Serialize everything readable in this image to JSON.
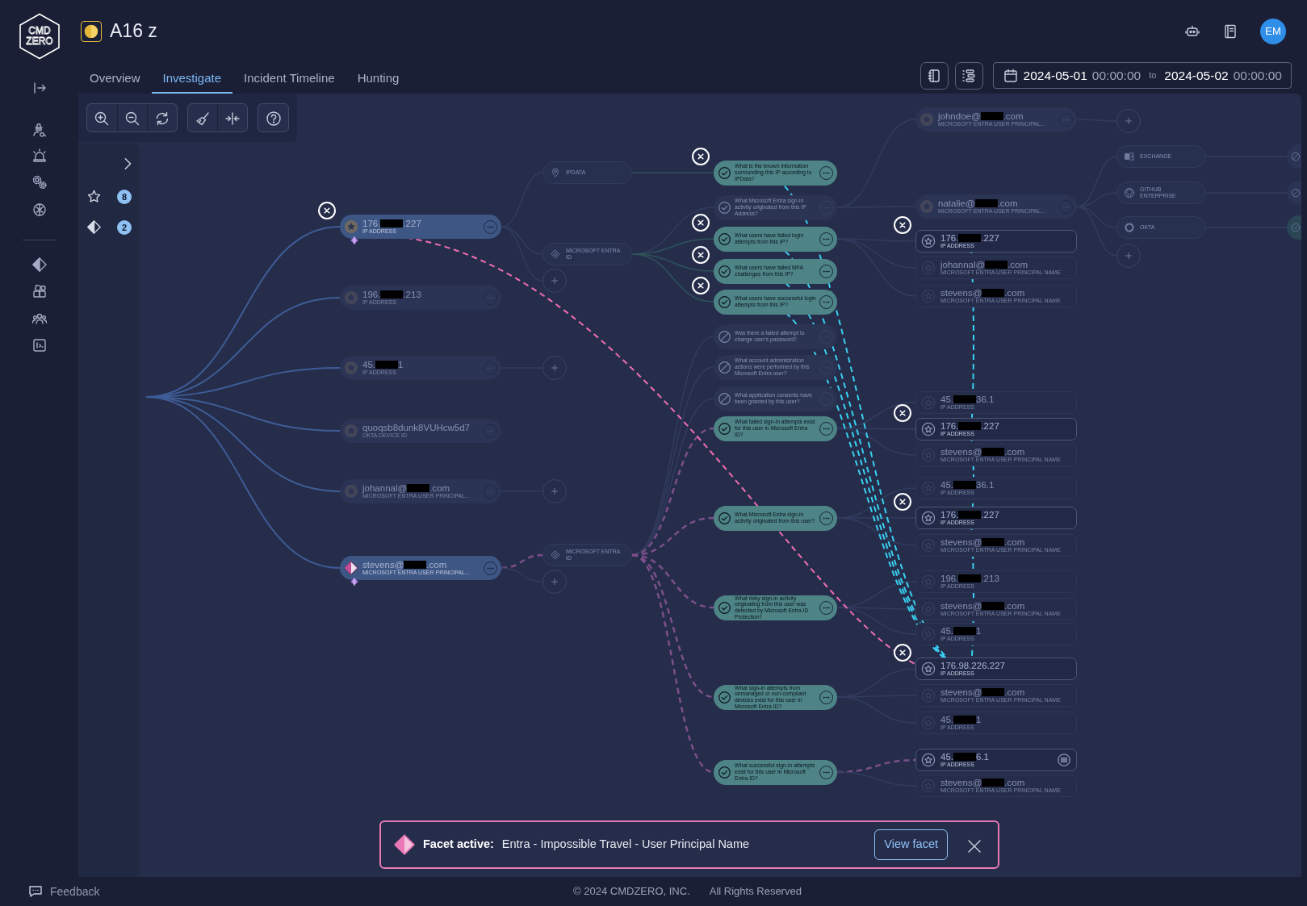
{
  "logo": {
    "lines": [
      "CMD",
      "ZERO"
    ]
  },
  "case": {
    "title": "A16 z"
  },
  "user": {
    "initials": "EM"
  },
  "tabs": [
    {
      "label": "Overview",
      "selected": false
    },
    {
      "label": "Investigate",
      "selected": true
    },
    {
      "label": "Incident Timeline",
      "selected": false
    },
    {
      "label": "Hunting",
      "selected": false
    }
  ],
  "date_range": {
    "start_date": "2024-05-01",
    "start_time": "00:00:00",
    "separator": "to",
    "end_date": "2024-05-02",
    "end_time": "00:00:00"
  },
  "side_panel": {
    "favorites_count": "8",
    "facets_count": "2"
  },
  "graph": {
    "nodes": [
      {
        "kind": "entity",
        "value": [
          "176.",
          ".227"
        ],
        "type": "IP ADDRESS",
        "dimmed": false,
        "pinned": true,
        "trail": {
          "color": "#ef6db0"
        },
        "facet_tag": true,
        "children": [
          {
            "kind": "integration",
            "name": "IPDATA",
            "children": [
              {
                "kind": "question",
                "text": "What is the known information surrounding this IP according to IPData?",
                "skipped": false,
                "dimmed": false,
                "pinned": true,
                "trail": {
                  "color": "#3ad1f2"
                }
              }
            ]
          },
          {
            "kind": "integration",
            "name": "MICROSOFT ENTRA ID",
            "children": [
              {
                "kind": "question",
                "text": "What Microsoft Entra sign-in activity originated from this IP Address?",
                "skipped": false,
                "dimmed": true,
                "children": [
                  {
                    "kind": "entity",
                    "value": [
                      "johndoe@",
                      ".com"
                    ],
                    "type": "MICROSOFT ENTRA USER PRINCIPAL...",
                    "dimmed": true,
                    "children": [
                      {
                        "kind": "add"
                      }
                    ]
                  },
                  {
                    "kind": "entity",
                    "value": [
                      "natalie@",
                      ".com"
                    ],
                    "type": "MICROSOFT ENTRA USER PRINCIPAL...",
                    "dimmed": true,
                    "children": [
                      {
                        "kind": "integration",
                        "name": "EXCHANGE",
                        "children": [
                          {
                            "kind": "stub",
                            "skipped": true
                          }
                        ]
                      },
                      {
                        "kind": "integration",
                        "name": "GITHUB ENTERPRISE",
                        "children": [
                          {
                            "kind": "stub",
                            "skipped": true
                          }
                        ]
                      },
                      {
                        "kind": "integration",
                        "name": "OKTA",
                        "children": [
                          {
                            "kind": "stub",
                            "skipped": false
                          }
                        ]
                      },
                      {
                        "kind": "add"
                      }
                    ]
                  }
                ]
              },
              {
                "kind": "question",
                "text": "What users have failed login attempts from this IP?",
                "skipped": false,
                "dimmed": false,
                "pinned": true,
                "trail": {
                  "color": "#3ad1f2"
                },
                "children": [
                  {
                    "kind": "result",
                    "value": [
                      "176.",
                      ".227"
                    ],
                    "type": "IP ADDRESS",
                    "dimmed": false,
                    "pinned": true,
                    "trail": {
                      "color": "#3ad1f2"
                    }
                  },
                  {
                    "kind": "result",
                    "value": [
                      "johannal@",
                      ".com"
                    ],
                    "type": "MICROSOFT ENTRA USER PRINCIPAL NAME",
                    "dimmed": true
                  },
                  {
                    "kind": "result",
                    "value": [
                      "stevens@",
                      ".com"
                    ],
                    "type": "MICROSOFT ENTRA USER PRINCIPAL NAME",
                    "dimmed": true
                  }
                ]
              },
              {
                "kind": "question",
                "text": "What users have failed MFA challenges from this IP?",
                "skipped": false,
                "dimmed": false,
                "pinned": true,
                "trail": {
                  "color": "#3ad1f2"
                }
              },
              {
                "kind": "question",
                "text": "What users have successful login attempts from this IP?",
                "skipped": false,
                "dimmed": false,
                "pinned": true,
                "trail": {
                  "color": "#3ad1f2"
                }
              }
            ]
          },
          {
            "kind": "add"
          }
        ]
      },
      {
        "kind": "entity",
        "value": [
          "196.",
          ".213"
        ],
        "type": "IP ADDRESS",
        "dimmed": true
      },
      {
        "kind": "entity",
        "value": [
          "45.",
          "1"
        ],
        "type": "IP ADDRESS",
        "dimmed": true,
        "children": [
          {
            "kind": "add"
          }
        ]
      },
      {
        "kind": "entity",
        "value": [
          "quoqsb8dunk8VUHcw5d7"
        ],
        "type": "OKTA DEVICE ID",
        "dimmed": true
      },
      {
        "kind": "entity",
        "value": [
          "johannal@",
          ".com"
        ],
        "type": "MICROSOFT ENTRA USER PRINCIPAL...",
        "dimmed": true,
        "children": [
          {
            "kind": "add"
          }
        ]
      },
      {
        "kind": "facet-entity",
        "value": [
          "stevens@",
          ".com"
        ],
        "type": "MICROSOFT ENTRA USER PRINCIPAL...",
        "dimmed": false,
        "facet_tag": true,
        "children": [
          {
            "kind": "integration",
            "name": "MICROSOFT ENTRA ID",
            "facet_path": true,
            "children": [
              {
                "kind": "question",
                "text": "Was there a failed attempt to change user's password?",
                "skipped": true,
                "dimmed": true
              },
              {
                "kind": "question",
                "text": "What account administration actions were performed by this Microsoft Entra user?",
                "skipped": true,
                "dimmed": true
              },
              {
                "kind": "question",
                "text": "What application consents have been granted by this user?",
                "skipped": true,
                "dimmed": true
              },
              {
                "kind": "question",
                "text": "What failed sign-in attempts exist for this user in Microsoft Entra ID?",
                "skipped": false,
                "dimmed": false,
                "facet_path": true,
                "children": [
                  {
                    "kind": "result",
                    "value": [
                      "45.",
                      "36.1"
                    ],
                    "type": "IP ADDRESS",
                    "dimmed": true
                  },
                  {
                    "kind": "result",
                    "value": [
                      "176.",
                      ".227"
                    ],
                    "type": "IP ADDRESS",
                    "dimmed": false,
                    "pinned": true,
                    "trail": {
                      "color": "#3ad1f2"
                    }
                  },
                  {
                    "kind": "result",
                    "value": [
                      "stevens@",
                      ".com"
                    ],
                    "type": "MICROSOFT ENTRA USER PRINCIPAL NAME",
                    "dimmed": true
                  }
                ]
              },
              {
                "kind": "question",
                "text": "What Microsoft Entra sign-in activity originated from this user?",
                "skipped": false,
                "dimmed": false,
                "facet_path": true,
                "children": [
                  {
                    "kind": "result",
                    "value": [
                      "45.",
                      "36.1"
                    ],
                    "type": "IP ADDRESS",
                    "dimmed": true
                  },
                  {
                    "kind": "result",
                    "value": [
                      "176.",
                      ".227"
                    ],
                    "type": "IP ADDRESS",
                    "dimmed": false,
                    "pinned": true,
                    "trail": {
                      "color": "#3ad1f2"
                    }
                  },
                  {
                    "kind": "result",
                    "value": [
                      "stevens@",
                      ".com"
                    ],
                    "type": "MICROSOFT ENTRA USER PRINCIPAL NAME",
                    "dimmed": true
                  }
                ]
              },
              {
                "kind": "question",
                "text": "What risky sign-in activity originating from this user was detected by Microsoft Entra ID Protection?",
                "skipped": false,
                "dimmed": false,
                "facet_path": true,
                "children": [
                  {
                    "kind": "result",
                    "value": [
                      "196.",
                      ".213"
                    ],
                    "type": "IP ADDRESS",
                    "dimmed": true
                  },
                  {
                    "kind": "result",
                    "value": [
                      "stevens@",
                      ".com"
                    ],
                    "type": "MICROSOFT ENTRA USER PRINCIPAL NAME",
                    "dimmed": true
                  },
                  {
                    "kind": "result",
                    "value": [
                      "45.",
                      "1"
                    ],
                    "type": "IP ADDRESS",
                    "dimmed": true
                  }
                ]
              },
              {
                "kind": "question",
                "text": "What sign-in attempts from unmanaged or non-compliant devices exist for this user in Microsoft Entra ID?",
                "skipped": false,
                "dimmed": false,
                "facet_path": true,
                "children": [
                  {
                    "kind": "result",
                    "value": [
                      "176.98.226.227"
                    ],
                    "type": "IP ADDRESS",
                    "dimmed": false,
                    "pinned": true,
                    "focus": true
                  },
                  {
                    "kind": "result",
                    "value": [
                      "stevens@",
                      ".com"
                    ],
                    "type": "MICROSOFT ENTRA USER PRINCIPAL NAME",
                    "dimmed": true
                  },
                  {
                    "kind": "result",
                    "value": [
                      "45.",
                      "1"
                    ],
                    "type": "IP ADDRESS",
                    "dimmed": true
                  }
                ]
              },
              {
                "kind": "question",
                "text": "What successful sign-in attempts exist for this user in Microsoft Entra ID?",
                "skipped": false,
                "dimmed": false,
                "facet_path": true,
                "children": [
                  {
                    "kind": "result",
                    "value": [
                      "45.",
                      "6.1"
                    ],
                    "type": "IP ADDRESS",
                    "dimmed": false,
                    "facet_path": true,
                    "linked": true
                  },
                  {
                    "kind": "result",
                    "value": [
                      "stevens@",
                      ".com"
                    ],
                    "type": "MICROSOFT ENTRA USER PRINCIPAL NAME",
                    "dimmed": true
                  }
                ]
              }
            ]
          },
          {
            "kind": "add"
          }
        ]
      }
    ]
  },
  "facet_banner": {
    "label": "Facet active:",
    "name": "Entra - Impossible Travel - User Principal Name",
    "button": "View facet"
  },
  "footer": {
    "feedback": "Feedback",
    "copyright": "© 2024 CMDZERO, INC.",
    "rights": "All Rights Reserved"
  }
}
